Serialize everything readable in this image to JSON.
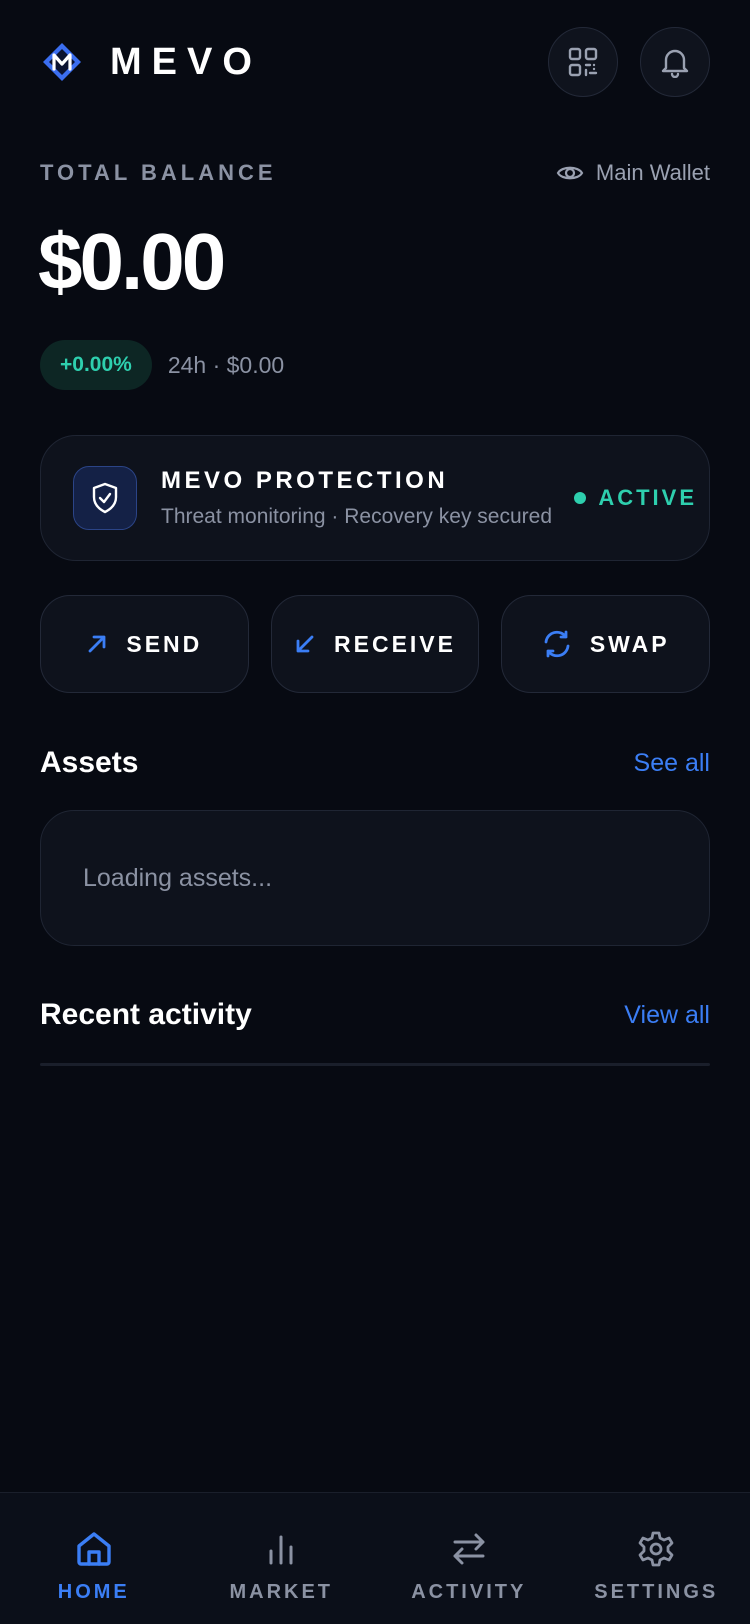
{
  "app": {
    "brand_name": "MEVO",
    "accent": "#3b7ef5",
    "positive": "#2ecfae"
  },
  "header": {
    "logo_icon": "mevo-logo-icon",
    "qr_icon": "qr-code-icon",
    "notification_icon": "bell-icon"
  },
  "balance": {
    "label": "TOTAL BALANCE",
    "wallet_name": "Main Wallet",
    "wallet_icon": "eye-icon",
    "amount": "$0.00",
    "change_percent": "+0.00%",
    "change_meta": "24h · $0.00"
  },
  "protection": {
    "icon": "shield-check-icon",
    "title": "MEVO PROTECTION",
    "subtitle": "Threat monitoring · Recovery key secured",
    "status": "ACTIVE"
  },
  "actions": [
    {
      "label": "SEND",
      "icon": "arrow-up-right-icon"
    },
    {
      "label": "RECEIVE",
      "icon": "arrow-down-left-icon"
    },
    {
      "label": "SWAP",
      "icon": "refresh-icon"
    }
  ],
  "assets": {
    "title": "Assets",
    "link": "See all",
    "loading_text": "Loading assets..."
  },
  "activity": {
    "title": "Recent activity",
    "link": "View all"
  },
  "nav": [
    {
      "label": "HOME",
      "icon": "home-icon",
      "active": true
    },
    {
      "label": "MARKET",
      "icon": "bar-chart-icon",
      "active": false
    },
    {
      "label": "ACTIVITY",
      "icon": "swap-arrows-icon",
      "active": false
    },
    {
      "label": "SETTINGS",
      "icon": "gear-icon",
      "active": false
    }
  ]
}
